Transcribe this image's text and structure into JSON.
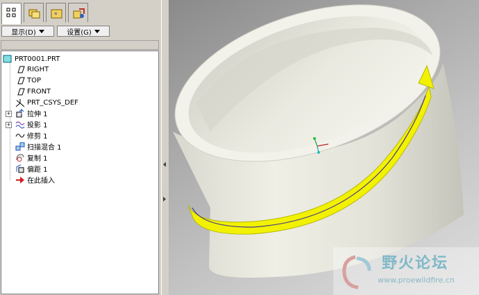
{
  "tabs": [
    {
      "name": "model-tree",
      "icon": "model-tree-icon",
      "active": true
    },
    {
      "name": "folder-browser",
      "icon": "folder-browser-icon",
      "active": false
    },
    {
      "name": "favorites",
      "icon": "favorites-icon",
      "active": false
    },
    {
      "name": "connections",
      "icon": "connections-icon",
      "active": false
    }
  ],
  "toolbar": {
    "display_label": "显示(D)",
    "settings_label": "设置(G)"
  },
  "tree": {
    "root": "PRT0001.PRT",
    "items": [
      {
        "label": "RIGHT",
        "icon": "datum-plane-icon"
      },
      {
        "label": "TOP",
        "icon": "datum-plane-icon"
      },
      {
        "label": "FRONT",
        "icon": "datum-plane-icon"
      },
      {
        "label": "PRT_CSYS_DEF",
        "icon": "coordinate-system-icon"
      },
      {
        "label": "拉伸 1",
        "icon": "extrude-icon",
        "expandable": true
      },
      {
        "label": "投影 1",
        "icon": "projection-icon",
        "expandable": true
      },
      {
        "label": "修剪 1",
        "icon": "trim-icon"
      },
      {
        "label": "扫描混合 1",
        "icon": "swept-blend-icon"
      },
      {
        "label": "复制 1",
        "icon": "copy-icon"
      },
      {
        "label": "偏距 1",
        "icon": "offset-icon"
      },
      {
        "label": "在此插入",
        "icon": "insert-here-arrow-icon"
      }
    ]
  },
  "watermark": {
    "text_cn": "野火论坛",
    "url": "www.proewildfire.cn"
  },
  "colors": {
    "panel_bg": "#d4d0c8",
    "cylinder": "#e6e6dc",
    "highlight_yellow": "#f2f200",
    "curve_blue": "#4a3a8a"
  }
}
